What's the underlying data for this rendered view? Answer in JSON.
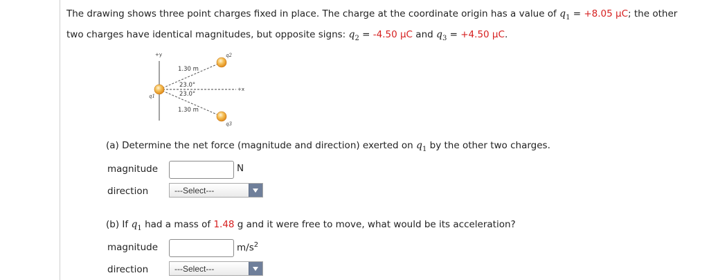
{
  "problem": {
    "line1_prefix": "The drawing shows three point charges fixed in place. The charge at the coordinate origin has a value of",
    "q1_symbol": "q",
    "q1_sub": "1",
    "q1_value": "+8.05 µC",
    "line1_suffix": "; the other",
    "line2_prefix": "two charges have identical magnitudes, but opposite signs:",
    "q2_symbol": "q",
    "q2_sub": "2",
    "q2_value": "-4.50 µC",
    "and": "and",
    "q3_symbol": "q",
    "q3_sub": "3",
    "q3_value": "+4.50 µC",
    "equals": "=",
    "period": "."
  },
  "diagram": {
    "y_axis": "+y",
    "x_axis": "+x",
    "dist_top": "1.30 m",
    "dist_bottom": "1.30 m",
    "angle_top": "23.0°",
    "angle_bottom": "23.0°",
    "q1_label": "q1",
    "q2_label": "q2",
    "q3_label": "q3"
  },
  "part_a": {
    "question_prefix": "(a) Determine the net force (magnitude and direction) exerted on",
    "q_symbol": "q",
    "q_sub": "1",
    "question_suffix": "by the other two charges.",
    "magnitude_label": "magnitude",
    "magnitude_value": "",
    "magnitude_unit": "N",
    "direction_label": "direction",
    "direction_selected": "---Select---"
  },
  "part_b": {
    "question_prefix": "(b) If",
    "q_symbol": "q",
    "q_sub": "1",
    "question_mid": "had a mass of",
    "mass_value": "1.48",
    "question_suffix": "g and it were free to move, what would be its acceleration?",
    "magnitude_label": "magnitude",
    "magnitude_value": "",
    "unit_base": "m/s",
    "unit_exp": "2",
    "direction_label": "direction",
    "direction_selected": "---Select---"
  },
  "colors": {
    "given_value": "#d62020",
    "charge_ball": "#f0a030",
    "select_arrow_bg": "#6f7f9a"
  }
}
